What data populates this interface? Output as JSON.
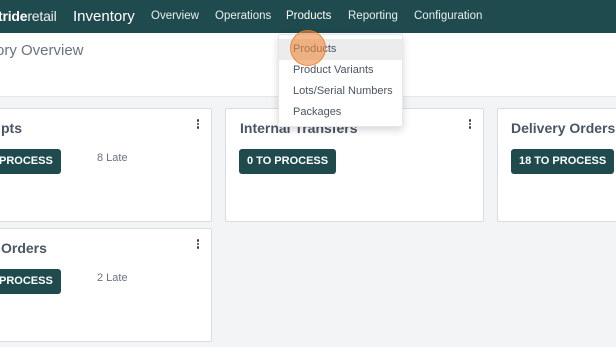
{
  "navbar": {
    "brand_bold": "tride",
    "brand_rest": "retail",
    "app_name": "Inventory",
    "items": [
      "Overview",
      "Operations",
      "Products",
      "Reporting",
      "Configuration"
    ]
  },
  "page": {
    "title": "ory Overview"
  },
  "cards": [
    {
      "title": "pts",
      "button": "PROCESS",
      "late": "8 Late"
    },
    {
      "title": "Internal Transfers",
      "button": "0 TO PROCESS"
    },
    {
      "title": "Delivery Orders",
      "button": "18 TO PROCESS"
    },
    {
      "title": "Orders",
      "button": "PROCESS",
      "late": "2 Late"
    }
  ],
  "dropdown": {
    "items": [
      "Products",
      "Product Variants",
      "Lots/Serial Numbers",
      "Packages"
    ]
  },
  "colors": {
    "navbar": "#1f4b4f",
    "primary_button": "#1f4b4f",
    "click_indicator": "#ee883c"
  }
}
